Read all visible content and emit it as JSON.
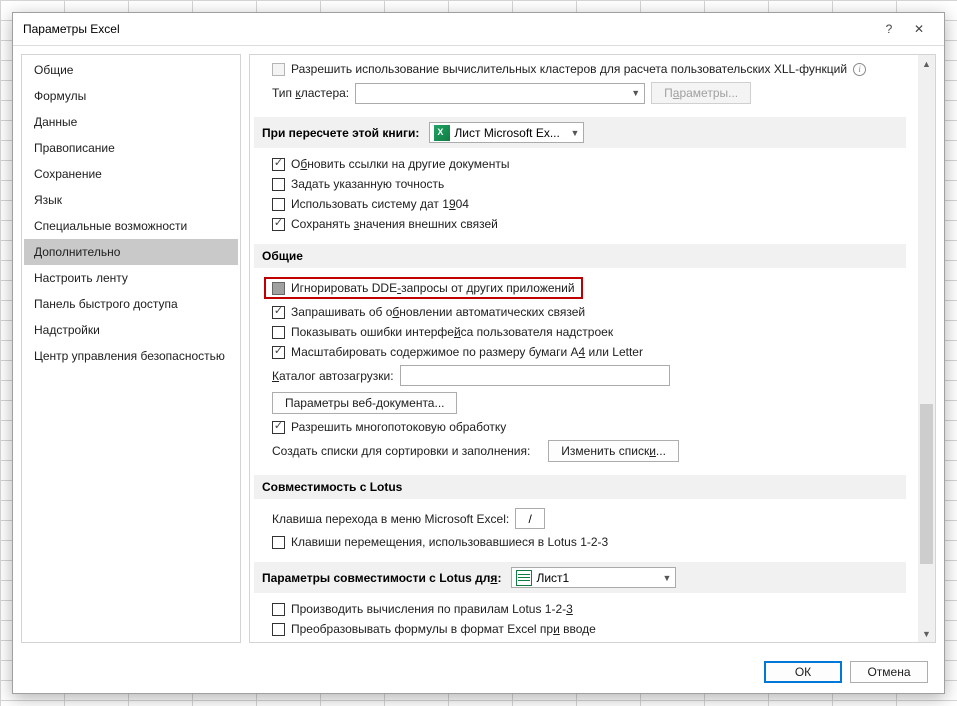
{
  "titlebar": {
    "title": "Параметры Excel",
    "help": "?",
    "close": "✕"
  },
  "sidebar": {
    "items": [
      {
        "label": "Общие"
      },
      {
        "label": "Формулы"
      },
      {
        "label": "Данные"
      },
      {
        "label": "Правописание"
      },
      {
        "label": "Сохранение"
      },
      {
        "label": "Язык"
      },
      {
        "label": "Специальные возможности"
      },
      {
        "label": "Дополнительно",
        "selected": true
      },
      {
        "label": "Настроить ленту"
      },
      {
        "label": "Панель быстрого доступа"
      },
      {
        "label": "Надстройки"
      },
      {
        "label": "Центр управления безопасностью"
      }
    ]
  },
  "content": {
    "allow_xll_label": "Разрешить использование вычислительных кластеров для расчета пользовательских XLL-функций",
    "cluster_type_label": "Тип кластера:",
    "cluster_type_value": "",
    "cluster_params_btn": "Параметры...",
    "recalc_section_label": "При пересчете этой книги:",
    "recalc_book_value": "Лист Microsoft Ex...",
    "recalc_items": {
      "update_links": "Обновить ссылки на другие документы",
      "set_precision": "Задать указанную точность",
      "use_1904": "Использовать систему дат 1904",
      "save_ext": "Сохранять значения внешних связей"
    },
    "general_section": "Общие",
    "general_items": {
      "ignore_dde": "Игнорировать DDE-запросы от других приложений",
      "ask_update": "Запрашивать об обновлении автоматических связей",
      "show_addin_err": "Показывать ошибки интерфейса пользователя надстроек",
      "scale_a4": "Масштабировать содержимое по размеру бумаги A4 или Letter",
      "startup_dir_label": "Каталог автозагрузки:",
      "startup_dir_value": "",
      "web_options_btn": "Параметры веб-документа...",
      "multithread": "Разрешить многопотоковую обработку",
      "create_lists_label": "Создать списки для сортировки и заполнения:",
      "edit_lists_btn": "Изменить списки..."
    },
    "lotus_compat_section": "Совместимость с Lotus",
    "lotus_items": {
      "menu_key_label": "Клавиша перехода в меню Microsoft Excel:",
      "menu_key_value": "/",
      "transition_nav": "Клавиши перемещения, использовавшиеся в Lotus 1-2-3"
    },
    "lotus_sheet_section_label": "Параметры совместимости с Lotus для:",
    "lotus_sheet_value": "Лист1",
    "lotus_sheet_items": {
      "calc_rules": "Производить вычисления по правилам Lotus 1-2-3",
      "convert_formulas": "Преобразовывать формулы в формат Excel при вводе"
    }
  },
  "footer": {
    "ok": "ОК",
    "cancel": "Отмена"
  }
}
